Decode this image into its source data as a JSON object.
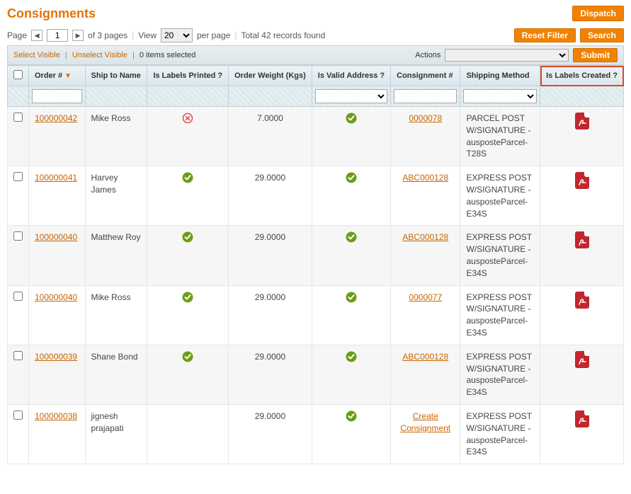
{
  "header": {
    "title": "Consignments",
    "dispatch_label": "Dispatch"
  },
  "pagination": {
    "page_label": "Page",
    "current_page": "1",
    "of_label": "of 3 pages",
    "view_label": "View",
    "per_page_value": "20",
    "per_page_suffix": "per page",
    "total_label": "Total 42 records found",
    "reset_filter_label": "Reset Filter",
    "search_label": "Search"
  },
  "massaction": {
    "select_visible": "Select Visible",
    "unselect_visible": "Unselect Visible",
    "selected_count": "0 items selected",
    "actions_label": "Actions",
    "submit_label": "Submit"
  },
  "columns": {
    "order_no": "Order #",
    "ship_to": "Ship to Name",
    "labels_printed": "Is Labels Printed ?",
    "order_weight": "Order Weight (Kgs)",
    "valid_address": "Is Valid Address ?",
    "consignment_no": "Consignment #",
    "shipping_method": "Shipping Method",
    "labels_created": "Is Labels Created ?"
  },
  "rows": [
    {
      "order": "100000042",
      "name": "Mike Ross",
      "printed": "cross",
      "weight": "7.0000",
      "valid": "tick",
      "consignment": "0000078",
      "method": "PARCEL POST W/SIGNATURE - ausposteParcel-T28S",
      "created": "pdf"
    },
    {
      "order": "100000041",
      "name": "Harvey James",
      "printed": "tick",
      "weight": "29.0000",
      "valid": "tick",
      "consignment": "ABC000128",
      "method": "EXPRESS POST W/SIGNATURE - ausposteParcel-E34S",
      "created": "pdf"
    },
    {
      "order": "100000040",
      "name": "Matthew Roy",
      "printed": "tick",
      "weight": "29.0000",
      "valid": "tick",
      "consignment": "ABC000128",
      "method": "EXPRESS POST W/SIGNATURE - ausposteParcel-E34S",
      "created": "pdf"
    },
    {
      "order": "100000040",
      "name": "Mike Ross",
      "printed": "tick",
      "weight": "29.0000",
      "valid": "tick",
      "consignment": "0000077",
      "method": "EXPRESS POST W/SIGNATURE - ausposteParcel-E34S",
      "created": "pdf"
    },
    {
      "order": "100000039",
      "name": "Shane Bond",
      "printed": "tick",
      "weight": "29.0000",
      "valid": "tick",
      "consignment": "ABC000128",
      "method": "EXPRESS POST W/SIGNATURE - ausposteParcel-E34S",
      "created": "pdf"
    },
    {
      "order": "100000038",
      "name": "jignesh prajapati",
      "printed": "",
      "weight": "29.0000",
      "valid": "tick",
      "consignment_action": "Create Consignment",
      "method": "EXPRESS POST W/SIGNATURE - ausposteParcel-E34S",
      "created": "pdf"
    }
  ]
}
